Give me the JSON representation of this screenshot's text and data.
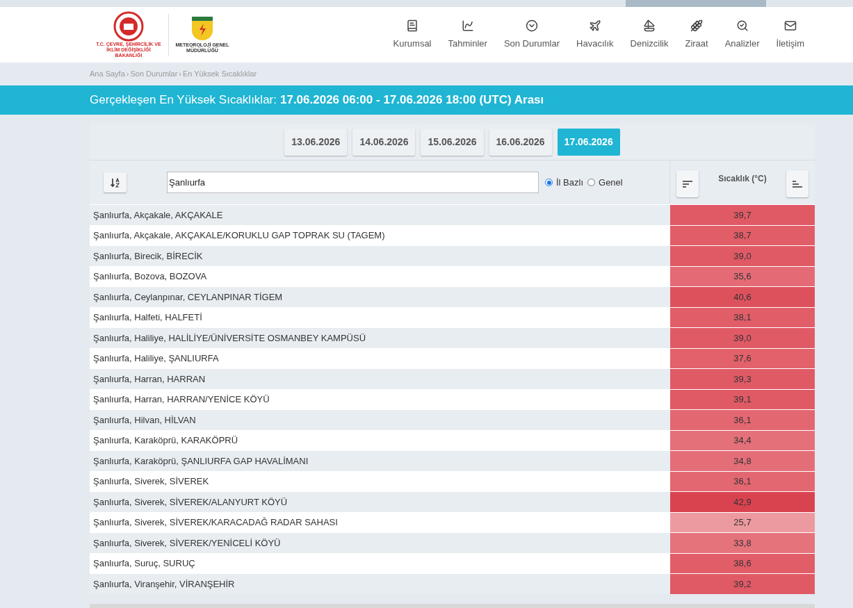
{
  "logos": {
    "ministry": "T.C. ÇEVRE, ŞEHİRCİLİK VE İKLİM DEĞİŞİKLİĞİ BAKANLIĞI",
    "mgm": "METEOROLOJİ GENEL MÜDÜRLÜĞÜ"
  },
  "nav": [
    {
      "label": "Kurumsal",
      "kind": "book"
    },
    {
      "label": "Tahminler",
      "kind": "chart"
    },
    {
      "label": "Son Durumlar",
      "kind": "chevron"
    },
    {
      "label": "Havacılık",
      "kind": "plane"
    },
    {
      "label": "Denizcilik",
      "kind": "sail"
    },
    {
      "label": "Ziraat",
      "kind": "wheat"
    },
    {
      "label": "Analizler",
      "kind": "analysis"
    },
    {
      "label": "İletişim",
      "kind": "mail"
    }
  ],
  "breadcrumb": {
    "separator": "›",
    "items": [
      "Ana Sayfa",
      "Son Durumlar",
      "En Yüksek Sıcaklıklar"
    ]
  },
  "title": {
    "label": "Gerçekleşen En Yüksek Sıcaklıklar:",
    "range": "17.06.2026 06:00 - 17.06.2026 18:00 (UTC) Arası"
  },
  "date_tabs": [
    {
      "label": "13.06.2026",
      "selected": false
    },
    {
      "label": "14.06.2026",
      "selected": false
    },
    {
      "label": "15.06.2026",
      "selected": false
    },
    {
      "label": "16.06.2026",
      "selected": false
    },
    {
      "label": "17.06.2026",
      "selected": true
    }
  ],
  "filter": {
    "value": "Şanlıurfa",
    "scope": [
      {
        "label": "İl Bazlı",
        "selected": true
      },
      {
        "label": "Genel",
        "selected": false
      }
    ]
  },
  "column_header": "Sıcaklık (°C)",
  "rows": [
    {
      "station": "Şanlıurfa, Akçakale, AKÇAKALE",
      "value": "39,7",
      "color": "#e05a66"
    },
    {
      "station": "Şanlıurfa, Akçakale, AKÇAKALE/KORUKLU GAP TOPRAK SU (TAGEM)",
      "value": "38,7",
      "color": "#e15d68"
    },
    {
      "station": "Şanlıurfa, Birecik, BİRECİK",
      "value": "39,0",
      "color": "#e05a66"
    },
    {
      "station": "Şanlıurfa, Bozova, BOZOVA",
      "value": "35,6",
      "color": "#e46b75"
    },
    {
      "station": "Şanlıurfa, Ceylanpınar, CEYLANPINAR TİGEM",
      "value": "40,6",
      "color": "#dd515d"
    },
    {
      "station": "Şanlıurfa, Halfeti, HALFETİ",
      "value": "38,1",
      "color": "#e15e69"
    },
    {
      "station": "Şanlıurfa, Haliliye, HALİLİYE/ÜNİVERSİTE OSMANBEY KAMPÜSÜ",
      "value": "39,0",
      "color": "#e05a66"
    },
    {
      "station": "Şanlıurfa, Haliliye, ŞANLIURFA",
      "value": "37,6",
      "color": "#e2616b"
    },
    {
      "station": "Şanlıurfa, Harran, HARRAN",
      "value": "39,3",
      "color": "#e05a66"
    },
    {
      "station": "Şanlıurfa, Harran, HARRAN/YENİCE KÖYÜ",
      "value": "39,1",
      "color": "#e05a66"
    },
    {
      "station": "Şanlıurfa, Hilvan, HİLVAN",
      "value": "36,1",
      "color": "#e36771"
    },
    {
      "station": "Şanlıurfa, Karaköprü, KARAKÖPRÜ",
      "value": "34,4",
      "color": "#e4707a"
    },
    {
      "station": "Şanlıurfa, Karaköprü, ŞANLIURFA GAP HAVALİMANI",
      "value": "34,8",
      "color": "#e46e78"
    },
    {
      "station": "Şanlıurfa, Siverek, SİVEREK",
      "value": "36,1",
      "color": "#e36771"
    },
    {
      "station": "Şanlıurfa, Siverek, SİVEREK/ALANYURT KÖYÜ",
      "value": "42,9",
      "color": "#d9434f"
    },
    {
      "station": "Şanlıurfa, Siverek, SİVEREK/KARACADAĞ RADAR SAHASI",
      "value": "25,7",
      "color": "#ec9a9f"
    },
    {
      "station": "Şanlıurfa, Siverek, SİVEREK/YENİCELİ KÖYÜ",
      "value": "33,8",
      "color": "#e5737c"
    },
    {
      "station": "Şanlıurfa, Suruç, SURUÇ",
      "value": "38,6",
      "color": "#e15d68"
    },
    {
      "station": "Şanlıurfa, Viranşehir, VİRANŞEHİR",
      "value": "39,2",
      "color": "#e05a66"
    }
  ]
}
